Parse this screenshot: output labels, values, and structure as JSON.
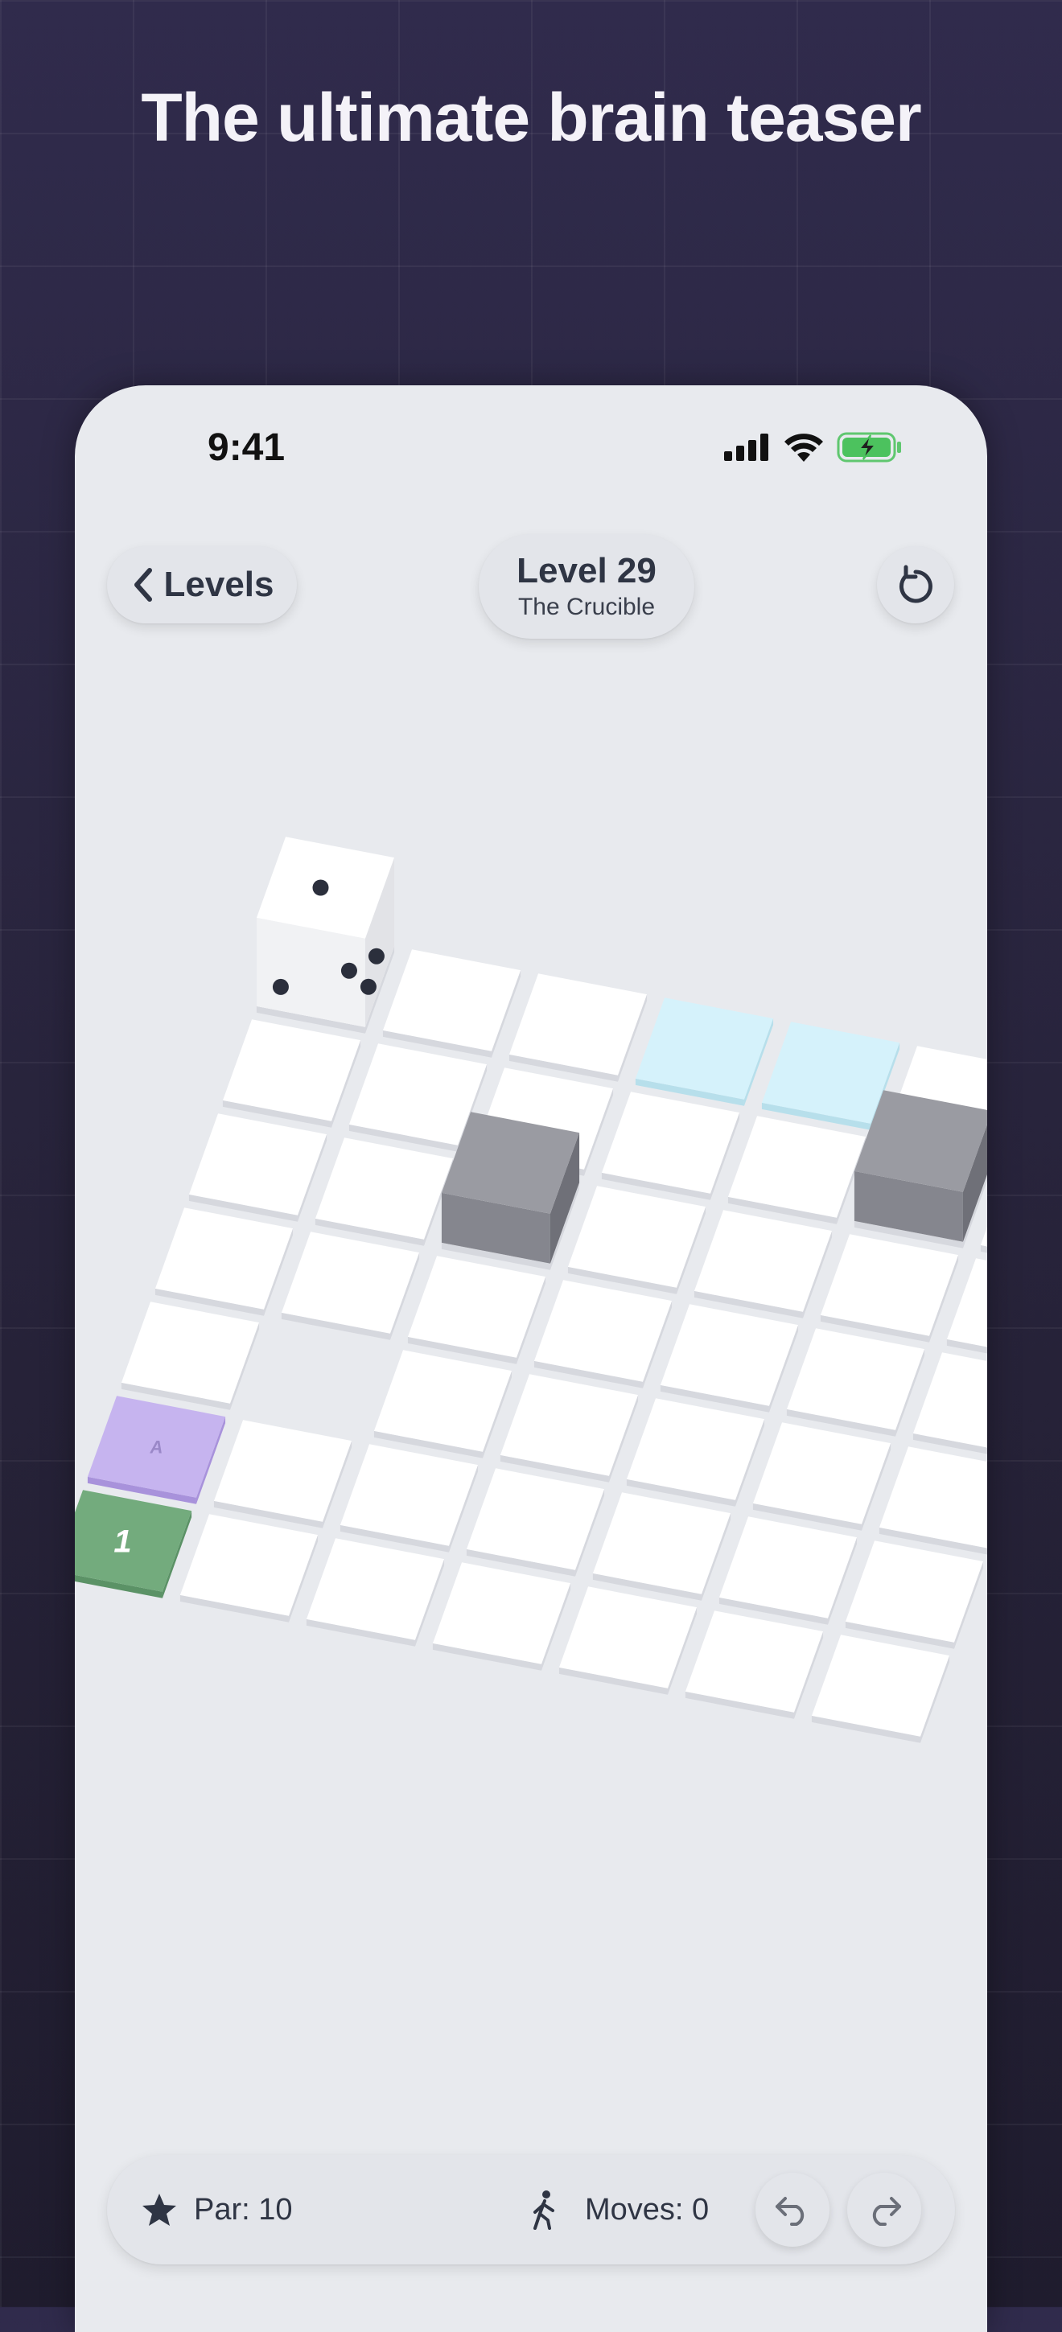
{
  "headline": "The ultimate brain teaser",
  "status": {
    "time": "9:41"
  },
  "header": {
    "back_label": "Levels",
    "level_title": "Level 29",
    "level_subtitle": "The Crucible"
  },
  "board": {
    "teleport_label": "A",
    "goal_label": "1",
    "colors": {
      "floor": "#ffffff",
      "ice": "#d5f2fb",
      "teleport": "#c6b4ef",
      "goal": "#73ab7d",
      "wall": "#8f9098"
    }
  },
  "footer": {
    "par_label": "Par: 10",
    "moves_label": "Moves: 0"
  },
  "icons": [
    "chevron-left-icon",
    "restart-icon",
    "star-icon",
    "walking-icon",
    "undo-icon",
    "redo-icon",
    "signal-icon",
    "wifi-icon",
    "battery-icon"
  ]
}
